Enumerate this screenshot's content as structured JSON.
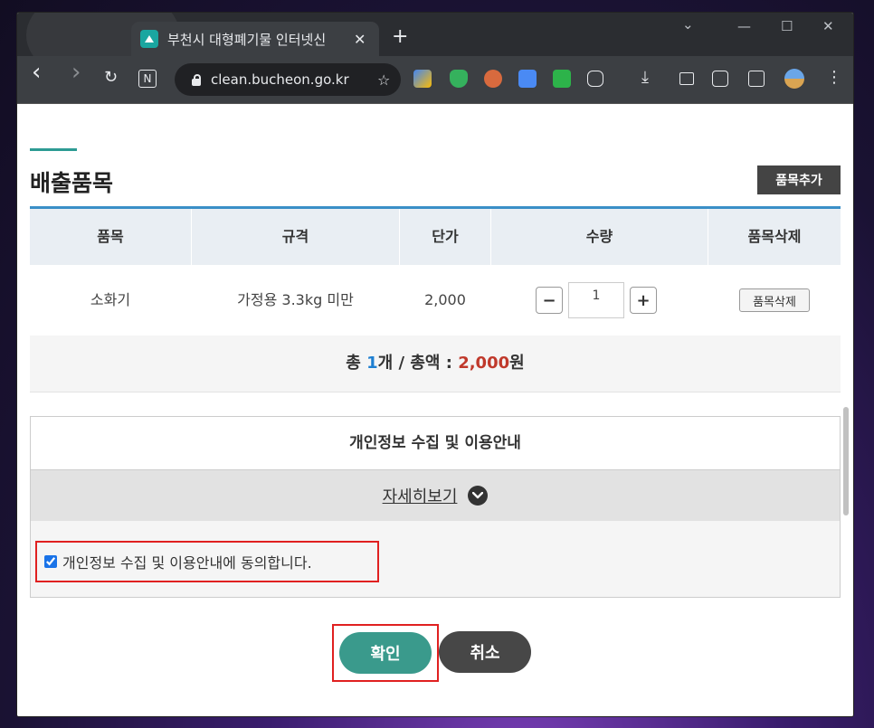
{
  "browser": {
    "tab_title": "부천시 대형폐기물 인터넷신",
    "tab_close": "✕",
    "new_tab": "+",
    "url": "clean.bucheon.go.kr",
    "controls": {
      "menu": "⌄",
      "minimize": "—",
      "maximize": "☐",
      "close": "✕"
    },
    "nav": {
      "back": "‹",
      "forward": "›",
      "reload": "↻",
      "notion": "N",
      "star": "☆",
      "download": "⤓",
      "more": "⋮"
    }
  },
  "page": {
    "section_title": "배출품목",
    "add_item_label": "품목추가",
    "table": {
      "headers": [
        "품목",
        "규격",
        "단가",
        "수량",
        "품목삭제"
      ],
      "rows": [
        {
          "item": "소화기",
          "spec": "가정용 3.3kg 미만",
          "price": "2,000",
          "quantity": "1",
          "delete_label": "품목삭제"
        }
      ],
      "minus": "−",
      "plus": "+"
    },
    "summary": {
      "prefix": "총 ",
      "count": "1",
      "middle": "개 / 총액 : ",
      "amount": "2,000",
      "suffix": "원"
    },
    "privacy": {
      "title": "개인정보 수집 및 이용안내",
      "details_label": "자세히보기",
      "consent_label": "개인정보 수집 및 이용안내에 동의합니다.",
      "consent_checked": true
    },
    "confirm_label": "확인",
    "cancel_label": "취소"
  },
  "colors": {
    "accent": "#2d9b93",
    "table_top": "#3a8fc7",
    "confirm": "#3a9a8c",
    "highlight": "#e02020"
  }
}
